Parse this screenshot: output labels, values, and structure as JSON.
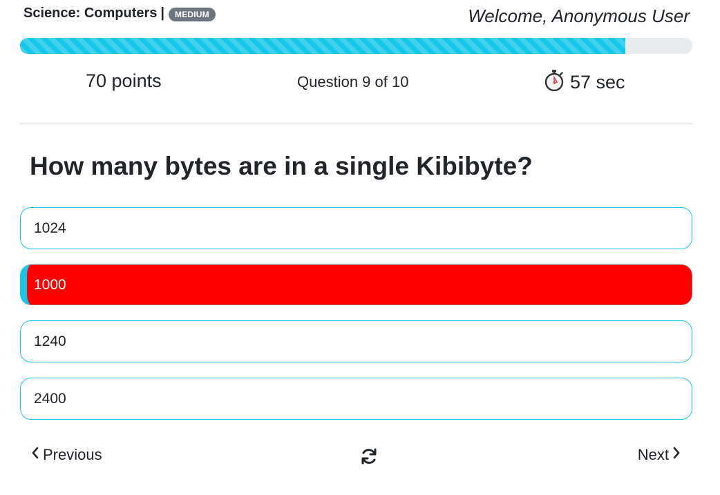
{
  "header": {
    "category": "Science: Computers",
    "separator": "|",
    "difficulty": "MEDIUM",
    "welcome": "Welcome, Anonymous User"
  },
  "progress": {
    "fraction": 0.9
  },
  "stats": {
    "points": "70 points",
    "question_counter": "Question 9 of 10",
    "timer": "57 sec",
    "timer_icon": "stopwatch-icon"
  },
  "question": "How many bytes are in a single Kibibyte?",
  "answers": [
    {
      "label": "1024",
      "state": "default"
    },
    {
      "label": "1000",
      "state": "selected-wrong"
    },
    {
      "label": "1240",
      "state": "default"
    },
    {
      "label": "2400",
      "state": "default"
    }
  ],
  "nav": {
    "previous": "Previous",
    "next": "Next",
    "previous_icon": "chevron-left-icon",
    "next_icon": "chevron-right-icon",
    "refresh_icon": "refresh-icon"
  },
  "colors": {
    "accent": "#17c7ea",
    "wrong": "#ff0000",
    "badge": "#6c757d"
  }
}
